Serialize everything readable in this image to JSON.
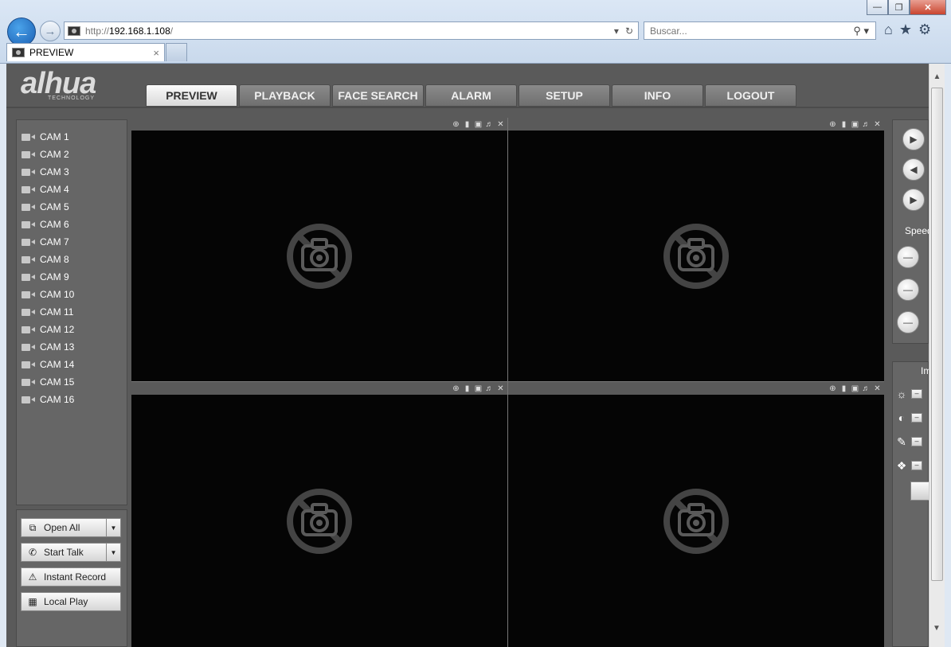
{
  "browser": {
    "window_buttons": [
      "—",
      "❐",
      "✕"
    ],
    "address": {
      "proto": "http://",
      "host": "192.168.1.108",
      "path": "/"
    },
    "search_placeholder": "Buscar...",
    "tab_title": "PREVIEW",
    "tab_close": "×"
  },
  "header": {
    "logo_main": "alhua",
    "logo_sub": "TECHNOLOGY",
    "tabs": [
      "PREVIEW",
      "PLAYBACK",
      "FACE SEARCH",
      "ALARM",
      "SETUP",
      "INFO",
      "LOGOUT"
    ],
    "active_tab": "PREVIEW"
  },
  "sidebar": {
    "cameras": [
      "CAM 1",
      "CAM 2",
      "CAM 3",
      "CAM 4",
      "CAM 5",
      "CAM 6",
      "CAM 7",
      "CAM 8",
      "CAM 9",
      "CAM 10",
      "CAM 11",
      "CAM 12",
      "CAM 13",
      "CAM 14",
      "CAM 15",
      "CAM 16"
    ]
  },
  "controls": {
    "open_all": "Open All",
    "start_talk": "Start Talk",
    "instant_record": "Instant Record",
    "local_play": "Local Play"
  },
  "ptz": {
    "speed_label": "Speed"
  },
  "image_panel": {
    "label": "Im"
  },
  "colors": {
    "selected_border": "#2eae2e",
    "accent_blue": "#1b5fb3"
  }
}
